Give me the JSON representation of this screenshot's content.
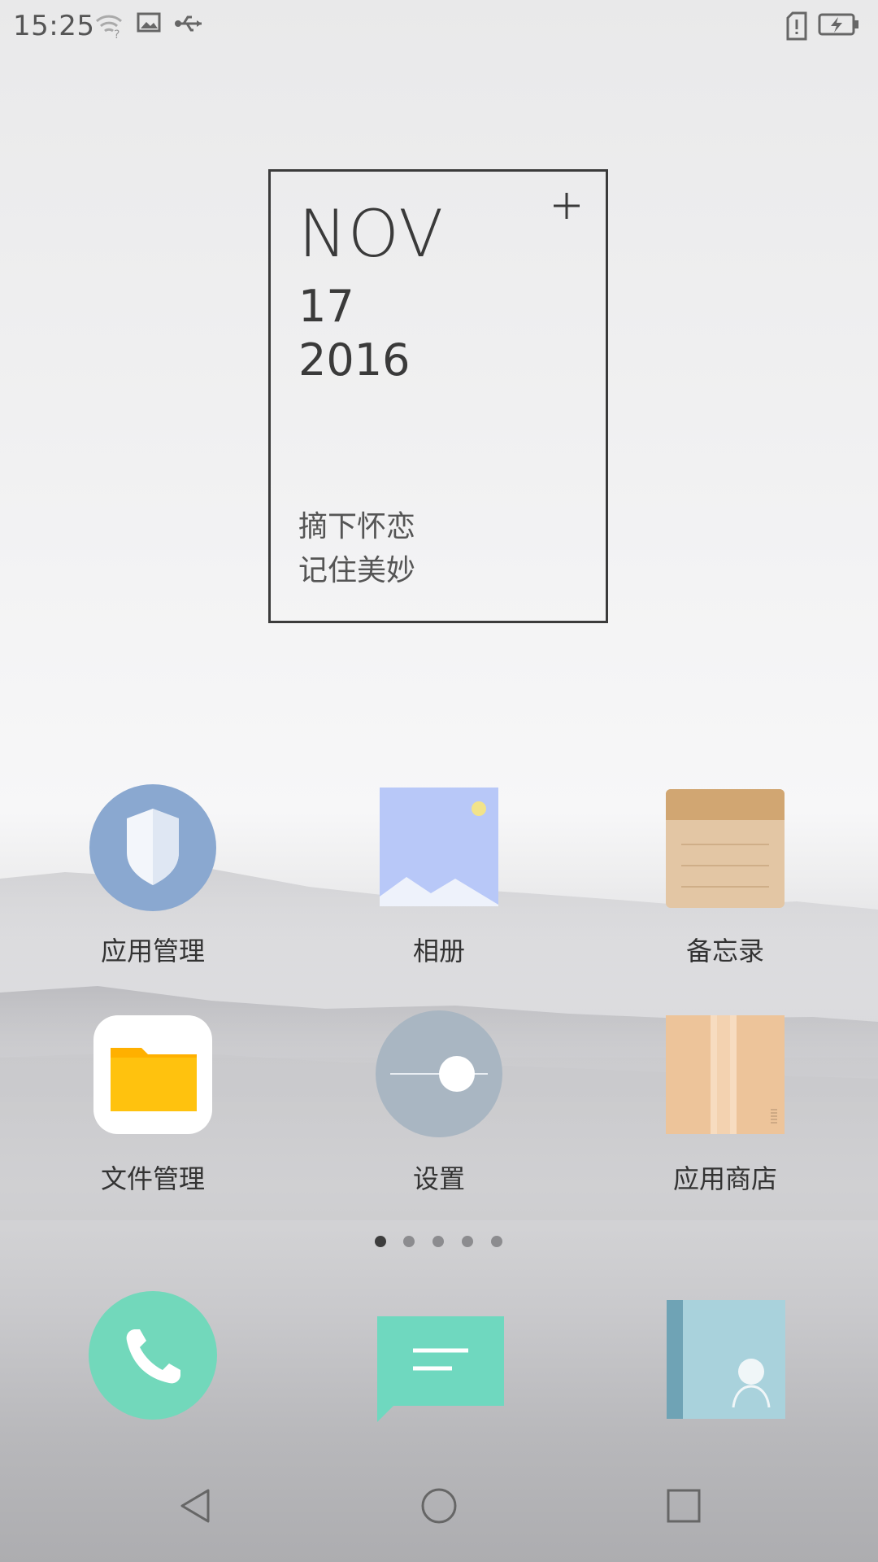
{
  "status_bar": {
    "time": "15:25",
    "icons": [
      "wifi-question-icon",
      "image-notification-icon",
      "usb-icon",
      "sim-alert-icon",
      "battery-charging-icon"
    ]
  },
  "calendar_widget": {
    "month": "NOV",
    "day": "17",
    "year": "2016",
    "add_icon": "plus-icon",
    "quote_line1": "摘下怀恋",
    "quote_line2": "记住美妙"
  },
  "apps": {
    "row1": [
      {
        "label": "应用管理",
        "icon": "shield-icon"
      },
      {
        "label": "相册",
        "icon": "gallery-icon"
      },
      {
        "label": "备忘录",
        "icon": "notepad-icon"
      }
    ],
    "row2": [
      {
        "label": "文件管理",
        "icon": "folder-icon"
      },
      {
        "label": "设置",
        "icon": "settings-toggle-icon"
      },
      {
        "label": "应用商店",
        "icon": "app-store-box-icon"
      }
    ]
  },
  "pager": {
    "pages": 5,
    "current": 1
  },
  "dock": [
    "phone-icon",
    "message-icon",
    "contacts-icon"
  ],
  "nav": [
    "back-icon",
    "home-icon",
    "recents-icon"
  ],
  "colors": {
    "shield_bg": "#8aa8d0",
    "gallery_bg": "#b8c8f8",
    "notepad_bg": "#e3c6a4",
    "folder": "#ffbf00",
    "settings_bg": "#a9b6c2",
    "store_bg": "#f0c9a0",
    "phone_bg": "#72d8bb",
    "message_bg": "#6fd8bf",
    "contacts_bg": "#a9d2dc"
  }
}
